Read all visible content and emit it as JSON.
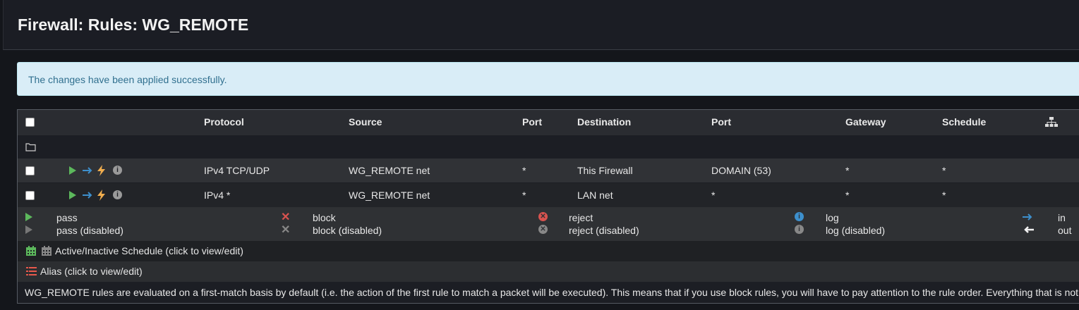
{
  "page": {
    "title": "Firewall: Rules: WG_REMOTE"
  },
  "alert": {
    "message": "The changes have been applied successfully."
  },
  "table": {
    "columns": {
      "protocol": "Protocol",
      "source": "Source",
      "port1": "Port",
      "destination": "Destination",
      "port2": "Port",
      "gateway": "Gateway",
      "schedule": "Schedule"
    },
    "rows": [
      {
        "protocol": "IPv4 TCP/UDP",
        "source": "WG_REMOTE net",
        "source_port": "*",
        "destination": "This Firewall",
        "dest_port": "DOMAIN (53)",
        "gateway": "*",
        "schedule": "*"
      },
      {
        "protocol": "IPv4 *",
        "source": "WG_REMOTE net",
        "source_port": "*",
        "destination": "LAN net",
        "dest_port": "*",
        "gateway": "*",
        "schedule": "*"
      }
    ]
  },
  "legend": {
    "pass": "pass",
    "pass_disabled": "pass (disabled)",
    "block": "block",
    "block_disabled": "block (disabled)",
    "reject": "reject",
    "reject_disabled": "reject (disabled)",
    "log": "log",
    "log_disabled": "log (disabled)",
    "in": "in",
    "out": "out"
  },
  "schedule_note": "Active/Inactive Schedule (click to view/edit)",
  "alias_note": "Alias (click to view/edit)",
  "footer_note": "WG_REMOTE rules are evaluated on a first-match basis by default (i.e. the action of the first rule to match a packet will be executed). This means that if you use block rules, you will have to pay attention to the rule order. Everything that is not e",
  "colors": {
    "pass": "#5cb85c",
    "in_arrow": "#3d8fcc",
    "lightning": "#f0ad4e",
    "reject": "#d9534f",
    "log": "#3d8fcc",
    "alert_bg": "#d9edf7"
  }
}
